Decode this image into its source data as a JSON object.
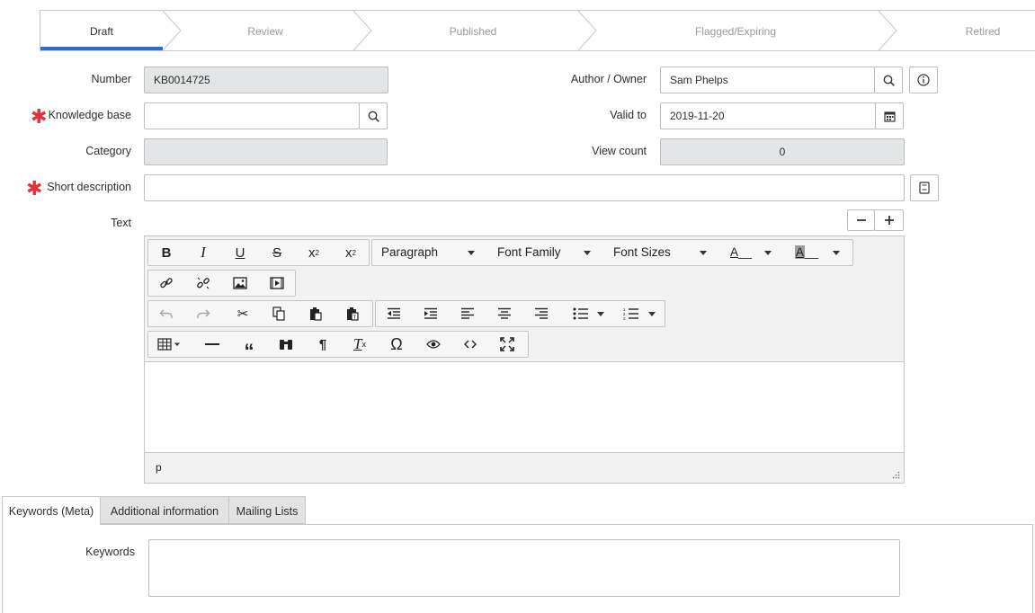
{
  "stages": [
    {
      "label": "Draft",
      "active": true
    },
    {
      "label": "Review",
      "active": false
    },
    {
      "label": "Published",
      "active": false
    },
    {
      "label": "Flagged/Expiring",
      "active": false
    },
    {
      "label": "Retired",
      "active": false
    }
  ],
  "form": {
    "number": {
      "label": "Number",
      "value": "KB0014725"
    },
    "knowledge_base": {
      "label": "Knowledge base",
      "value": ""
    },
    "category": {
      "label": "Category",
      "value": ""
    },
    "short_description": {
      "label": "Short description",
      "value": ""
    },
    "author": {
      "label": "Author / Owner",
      "value": "Sam Phelps"
    },
    "valid_to": {
      "label": "Valid to",
      "value": "2019-11-20"
    },
    "view_count": {
      "label": "View count",
      "value": "0"
    },
    "text": {
      "label": "Text"
    }
  },
  "editor": {
    "format_dropdowns": {
      "paragraph": "Paragraph",
      "font_family": "Font Family",
      "font_sizes": "Font Sizes"
    },
    "text_color_label": "A",
    "bg_color_label": "A",
    "status_path": "p"
  },
  "tabs": [
    {
      "label": "Keywords (Meta)",
      "active": true
    },
    {
      "label": "Additional information",
      "active": false
    },
    {
      "label": "Mailing Lists",
      "active": false
    }
  ],
  "keywords": {
    "label": "Keywords",
    "value": ""
  },
  "colors": {
    "accent": "#2e6cc7",
    "required": "#e0343a",
    "readonly": "#e4e5e6"
  }
}
